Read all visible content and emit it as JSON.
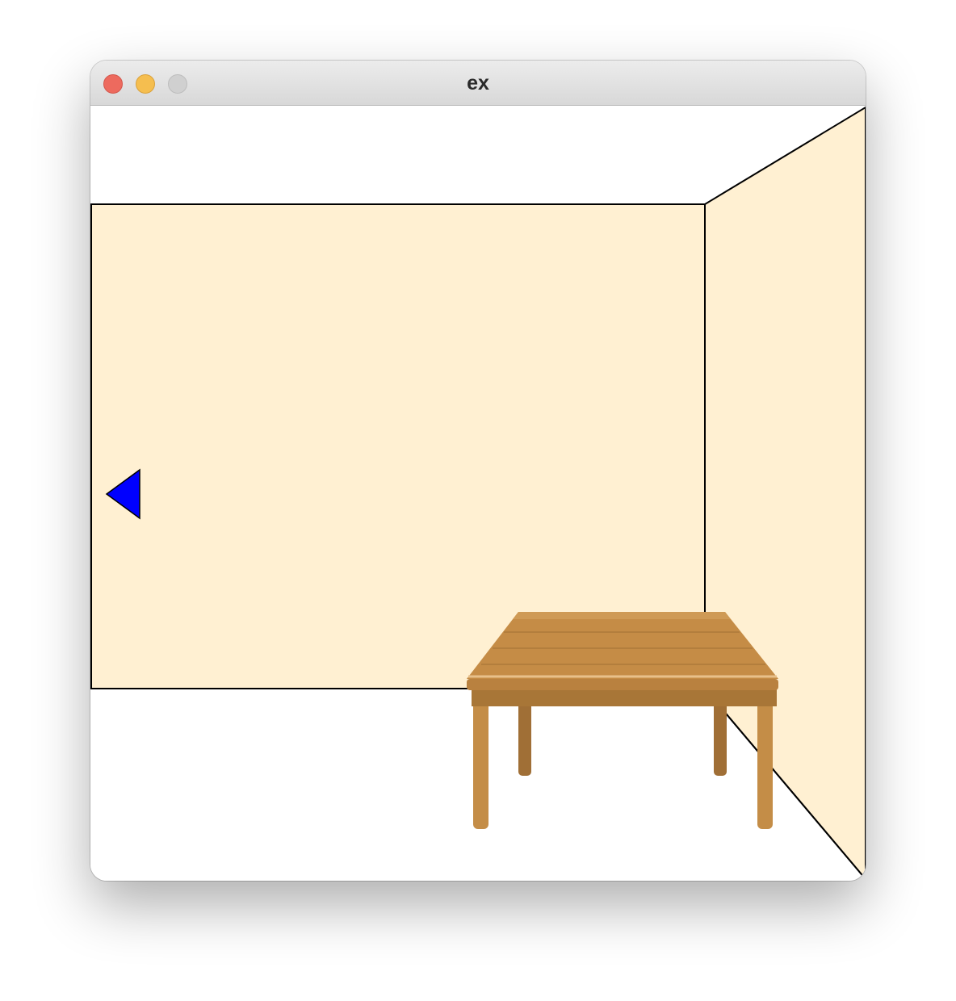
{
  "window": {
    "title": "ex",
    "controls": [
      "close",
      "minimize",
      "zoom"
    ]
  },
  "scene": {
    "wall_color": "#fff0d2",
    "outline_color": "#000000",
    "floor_color": "#ffffff",
    "nav_arrow": {
      "direction": "left",
      "icon": "left-triangle-icon",
      "color": "#0000ff"
    },
    "furniture": [
      {
        "name": "table",
        "icon": "wooden-table-icon",
        "color": "#c58c46"
      }
    ]
  }
}
